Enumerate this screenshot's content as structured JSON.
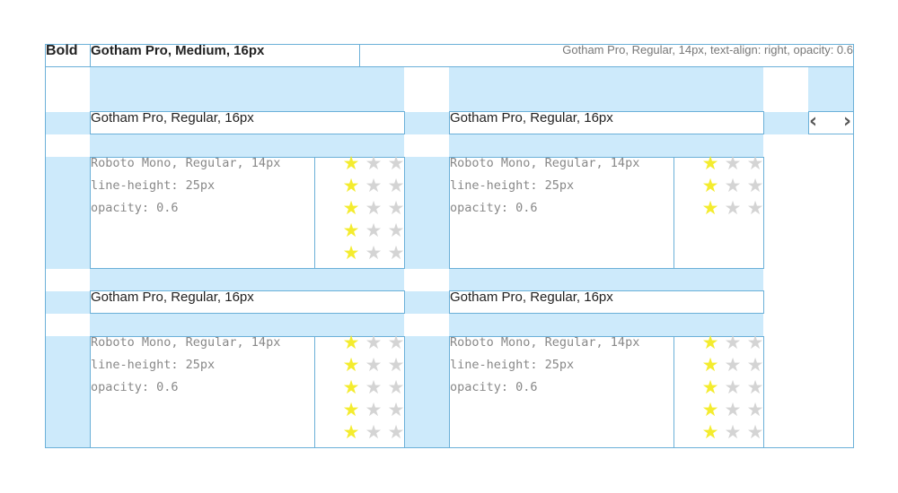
{
  "header": {
    "bold_label": "Bold",
    "title_spec": "Gotham Pro, Medium, 16px",
    "right_spec": "Gotham Pro, Regular, 14px, text-align: right, opacity: 0.6"
  },
  "cards": [
    {
      "title": "Gotham Pro, Regular, 16px",
      "lines": [
        "Roboto Mono, Regular, 14px",
        "line-height: 25px",
        "opacity: 0.6"
      ],
      "ratings": [
        1,
        1,
        1,
        1,
        1
      ]
    },
    {
      "title": "Gotham Pro, Regular, 16px",
      "lines": [
        "Roboto Mono, Regular, 14px",
        "line-height: 25px",
        "opacity: 0.6"
      ],
      "ratings": [
        1,
        1,
        1
      ]
    },
    {
      "title": "Gotham Pro, Regular, 16px",
      "lines": [
        "Roboto Mono, Regular, 14px",
        "line-height: 25px",
        "opacity: 0.6"
      ],
      "ratings": [
        1,
        1,
        1,
        1,
        1
      ]
    },
    {
      "title": "Gotham Pro, Regular, 16px",
      "lines": [
        "Roboto Mono, Regular, 14px",
        "line-height: 25px",
        "opacity: 0.6"
      ],
      "ratings": [
        1,
        1,
        1,
        1,
        1
      ]
    }
  ],
  "rating_max": 3,
  "pager": {
    "prev_icon": "chevron-left-icon",
    "next_icon": "chevron-right-icon"
  },
  "colors": {
    "guide_fill": "#cdeafb",
    "guide_outline": "#6bb0d8",
    "star_on": "#f4ec2e",
    "star_off": "#d4d4d4"
  }
}
